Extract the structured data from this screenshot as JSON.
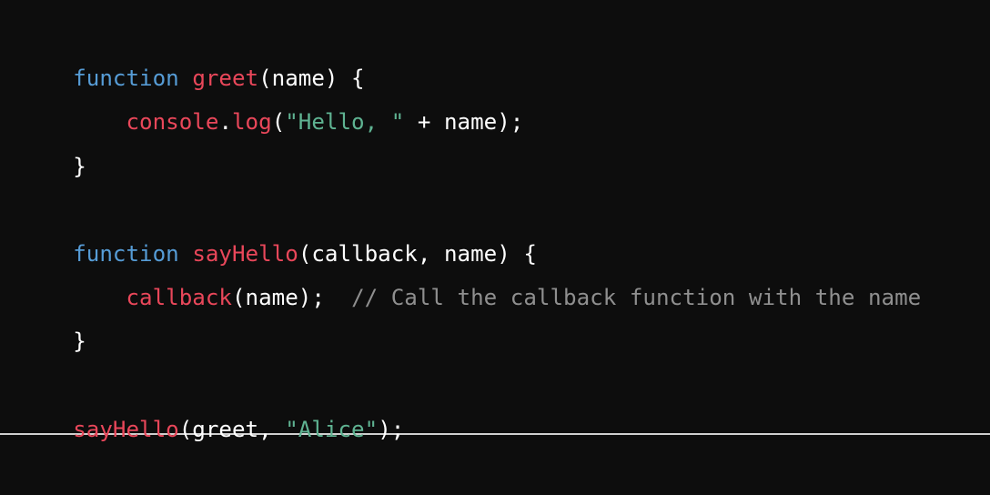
{
  "colors": {
    "background": "#0d0d0d",
    "keyword": "#569cd6",
    "function": "#e9475a",
    "string": "#5fb392",
    "comment": "#8f8f8f",
    "plain": "#ffffff"
  },
  "lines": [
    [
      {
        "t": "function",
        "k": "keyword"
      },
      {
        "t": " ",
        "k": "plain"
      },
      {
        "t": "greet",
        "k": "function"
      },
      {
        "t": "(name) {",
        "k": "plain"
      }
    ],
    [
      {
        "t": "    ",
        "k": "plain"
      },
      {
        "t": "console",
        "k": "function"
      },
      {
        "t": ".",
        "k": "plain"
      },
      {
        "t": "log",
        "k": "function"
      },
      {
        "t": "(",
        "k": "plain"
      },
      {
        "t": "\"Hello, \"",
        "k": "string"
      },
      {
        "t": " + name);",
        "k": "plain"
      }
    ],
    [
      {
        "t": "}",
        "k": "plain"
      }
    ],
    [],
    [
      {
        "t": "function",
        "k": "keyword"
      },
      {
        "t": " ",
        "k": "plain"
      },
      {
        "t": "sayHello",
        "k": "function"
      },
      {
        "t": "(callback, name) {",
        "k": "plain"
      }
    ],
    [
      {
        "t": "    ",
        "k": "plain"
      },
      {
        "t": "callback",
        "k": "function"
      },
      {
        "t": "(name);  ",
        "k": "plain"
      },
      {
        "t": "// Call the callback function with the name",
        "k": "comment"
      }
    ],
    [
      {
        "t": "}",
        "k": "plain"
      }
    ],
    [],
    [
      {
        "t": "sayHello",
        "k": "function"
      },
      {
        "t": "(greet, ",
        "k": "plain"
      },
      {
        "t": "\"Alice\"",
        "k": "string"
      },
      {
        "t": ");",
        "k": "plain"
      }
    ]
  ]
}
